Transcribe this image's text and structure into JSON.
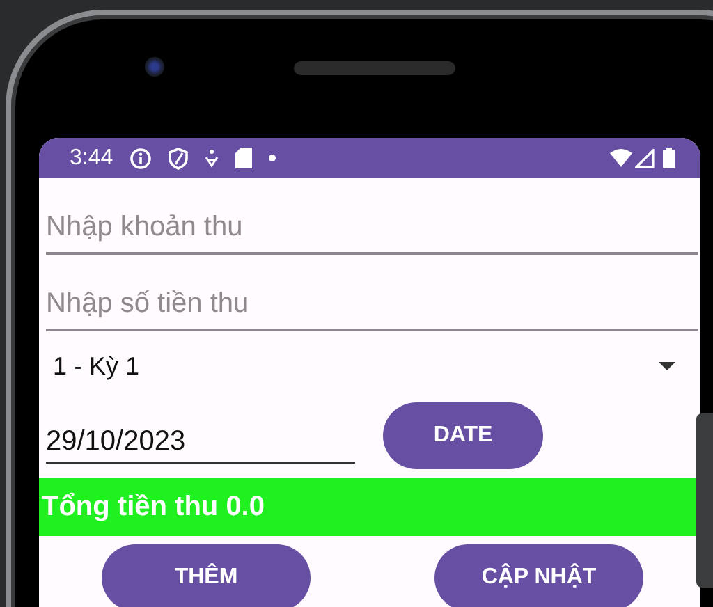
{
  "status_bar": {
    "time": "3:44"
  },
  "fields": [
    {
      "placeholder": "Nhập khoản thu"
    },
    {
      "placeholder": "Nhập số tiền thu"
    }
  ],
  "spinner": {
    "value": "1 - Kỳ 1"
  },
  "date_field": {
    "value": "29/10/2023"
  },
  "date_button": {
    "label": "DATE"
  },
  "total": {
    "text": "Tổng tiền thu 0.0"
  },
  "buttons": [
    {
      "label": "THÊM"
    },
    {
      "label": "CẬP NHẬT"
    }
  ]
}
